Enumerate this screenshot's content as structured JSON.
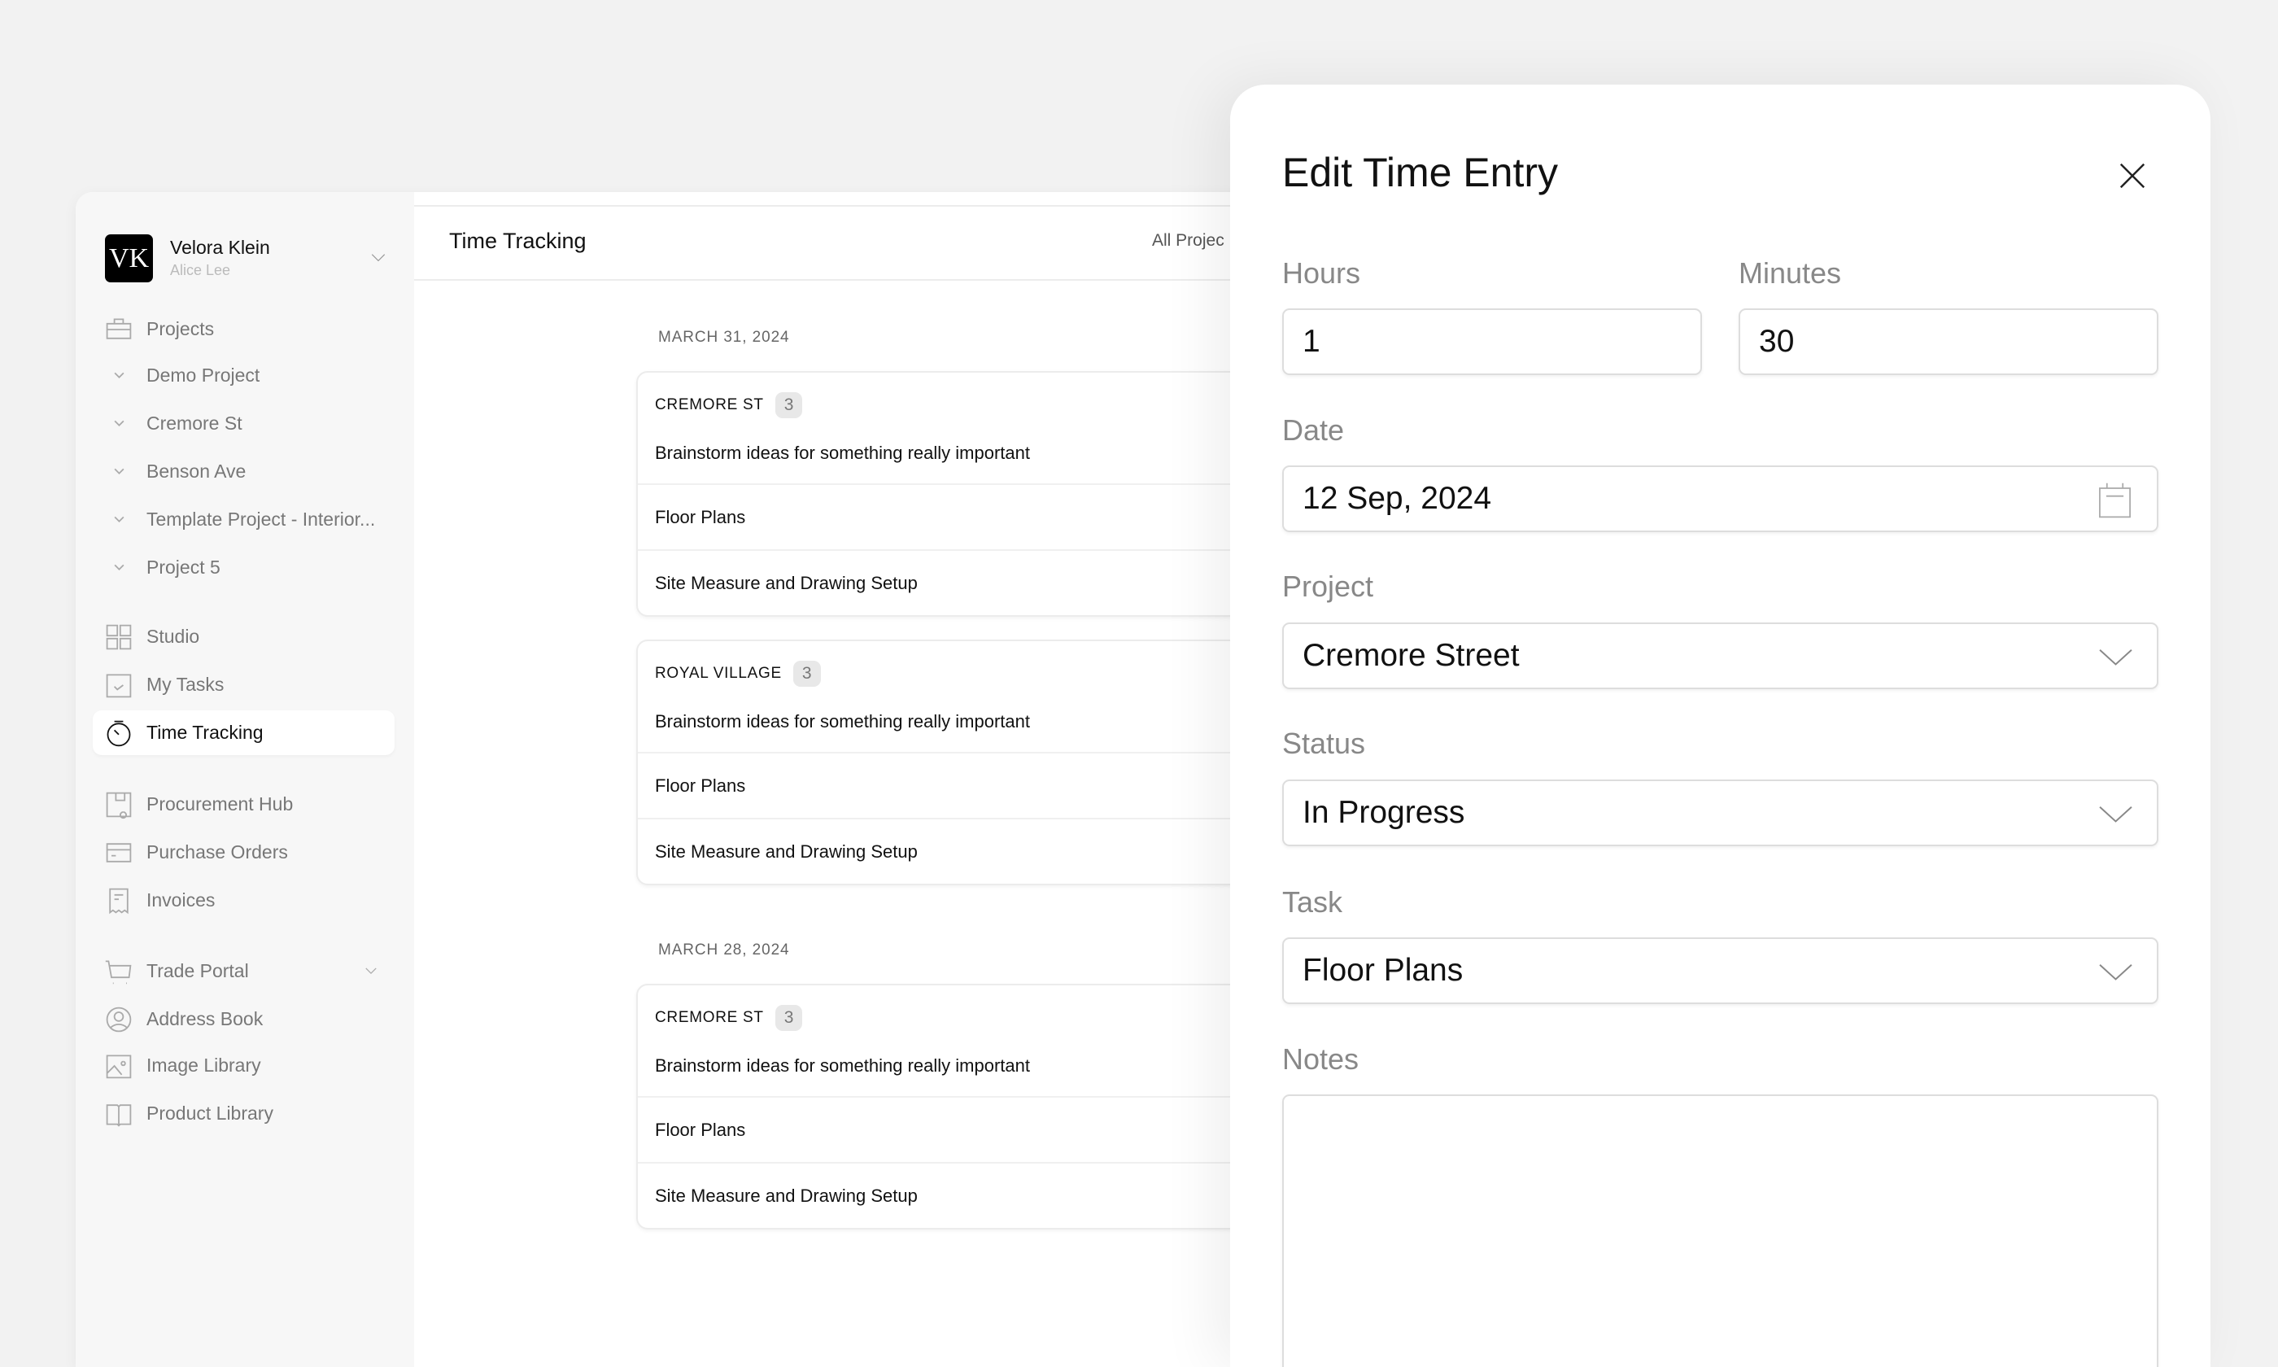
{
  "sidebar": {
    "avatar_initials": "VK",
    "user_name": "Velora Klein",
    "user_sub": "Alice Lee",
    "items": [
      {
        "label": "Projects",
        "icon": "briefcase-icon"
      },
      {
        "label": "Demo Project",
        "icon": "chevron-down-icon"
      },
      {
        "label": "Cremore St",
        "icon": "chevron-down-icon"
      },
      {
        "label": "Benson Ave",
        "icon": "chevron-down-icon"
      },
      {
        "label": "Template Project - Interior...",
        "icon": "chevron-down-icon"
      },
      {
        "label": "Project 5",
        "icon": "chevron-down-icon"
      },
      {
        "label": "Studio",
        "icon": "grid-icon"
      },
      {
        "label": "My Tasks",
        "icon": "checkbox-icon"
      },
      {
        "label": "Time Tracking",
        "icon": "stopwatch-icon",
        "active": true
      },
      {
        "label": "Procurement Hub",
        "icon": "box-icon"
      },
      {
        "label": "Purchase Orders",
        "icon": "card-icon"
      },
      {
        "label": "Invoices",
        "icon": "receipt-icon"
      },
      {
        "label": "Trade Portal",
        "icon": "cart-icon"
      },
      {
        "label": "Address Book",
        "icon": "user-circle-icon"
      },
      {
        "label": "Image Library",
        "icon": "image-icon"
      },
      {
        "label": "Product Library",
        "icon": "book-icon"
      }
    ]
  },
  "main": {
    "title": "Time Tracking",
    "filter": "All Projec",
    "groups": [
      {
        "date": "MARCH 31, 2024",
        "cards": [
          {
            "project": "CREMORE ST",
            "count": "3",
            "tasks": [
              "Brainstorm ideas for something really important",
              "Floor Plans",
              "Site Measure and Drawing Setup"
            ]
          },
          {
            "project": "ROYAL VILLAGE",
            "count": "3",
            "tasks": [
              "Brainstorm ideas for something really important",
              "Floor Plans",
              "Site Measure and Drawing Setup"
            ]
          }
        ]
      },
      {
        "date": "MARCH 28, 2024",
        "cards": [
          {
            "project": "CREMORE ST",
            "count": "3",
            "tasks": [
              "Brainstorm ideas for something really important",
              "Floor Plans",
              "Site Measure and Drawing Setup"
            ]
          }
        ]
      }
    ]
  },
  "modal": {
    "title": "Edit Time Entry",
    "hours_label": "Hours",
    "hours_value": "1",
    "minutes_label": "Minutes",
    "minutes_value": "30",
    "date_label": "Date",
    "date_value": "12 Sep, 2024",
    "project_label": "Project",
    "project_value": "Cremore Street",
    "status_label": "Status",
    "status_value": "In Progress",
    "task_label": "Task",
    "task_value": "Floor Plans",
    "notes_label": "Notes",
    "notes_value": ""
  }
}
